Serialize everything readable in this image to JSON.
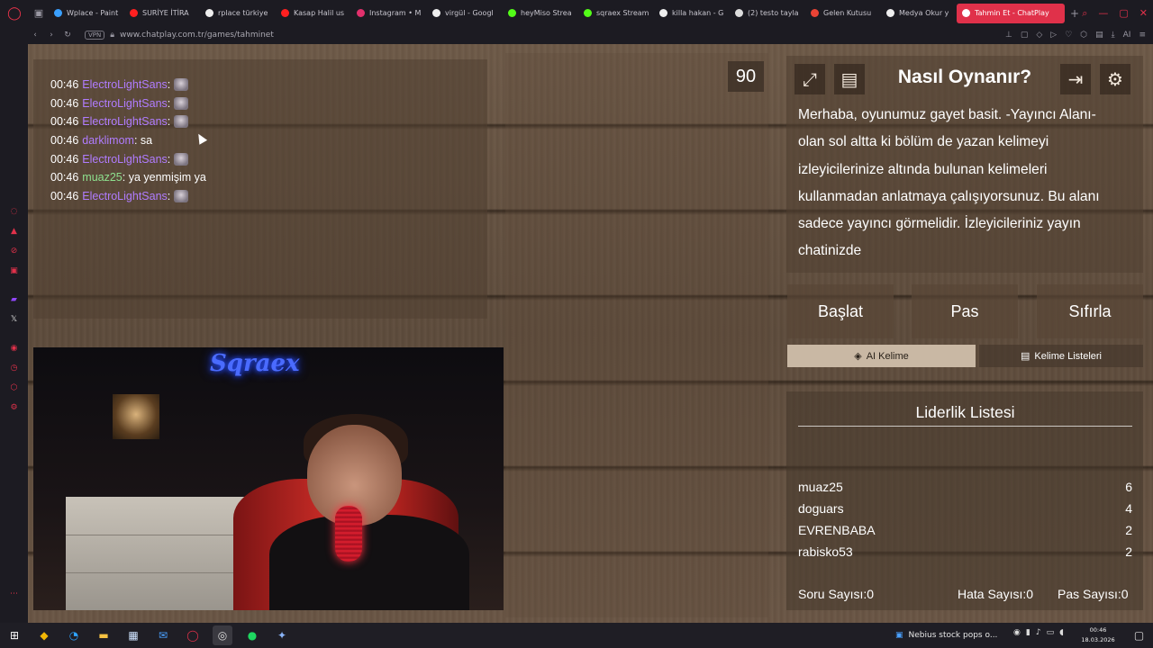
{
  "browser": {
    "tabs": [
      {
        "label": "Wplace - Paint",
        "color": "#3aa0ff"
      },
      {
        "label": "SURİYE İTİRA",
        "color": "#ff2020"
      },
      {
        "label": "rplace türkiye",
        "color": "#eeeeee"
      },
      {
        "label": "Kasap Halil us",
        "color": "#ff2020"
      },
      {
        "label": "Instagram • M",
        "color": "#e1306c"
      },
      {
        "label": "virgül - Googl",
        "color": "#eeeeee"
      },
      {
        "label": "heyMiso Strea",
        "color": "#53fc18"
      },
      {
        "label": "sqraex Stream",
        "color": "#53fc18"
      },
      {
        "label": "killa hakan - G",
        "color": "#eeeeee"
      },
      {
        "label": "(2) testo tayla",
        "color": "#dddddd"
      },
      {
        "label": "Gelen Kutusu",
        "color": "#ea4335"
      },
      {
        "label": "Medya Okur y",
        "color": "#eeeeee"
      },
      {
        "label": "Tahmin Et - ChatPlay",
        "color": "#ffffff",
        "active": true
      }
    ],
    "url": "www.chatplay.com.tr/games/tahminet",
    "vpn_label": "VPN",
    "ai_label": "AI"
  },
  "chat": {
    "messages": [
      {
        "time": "00:46",
        "user": "ElectroLightSans",
        "sep": ":",
        "text": "",
        "emote": true,
        "green": false
      },
      {
        "time": "00:46",
        "user": "ElectroLightSans",
        "sep": ":",
        "text": "",
        "emote": true,
        "green": false
      },
      {
        "time": "00:46",
        "user": "ElectroLightSans",
        "sep": ":",
        "text": "",
        "emote": true,
        "green": false
      },
      {
        "time": "00:46",
        "user": "darklimom",
        "sep": ":",
        "text": " sa",
        "emote": false,
        "green": false
      },
      {
        "time": "00:46",
        "user": "ElectroLightSans",
        "sep": ":",
        "text": "",
        "emote": true,
        "green": false
      },
      {
        "time": "00:46",
        "user": "muaz25",
        "sep": ":",
        "text": " ya yenmişim ya",
        "emote": false,
        "green": true
      },
      {
        "time": "00:46",
        "user": "ElectroLightSans",
        "sep": ":",
        "text": "",
        "emote": true,
        "green": false
      }
    ]
  },
  "webcam": {
    "neon_sign": "Sqraex"
  },
  "game": {
    "timer": "90",
    "how_to_title": "Nasıl Oynanır?",
    "how_to_text": "Merhaba, oyunumuz gayet basit. -Yayıncı Alanı- olan sol altta ki bölüm de yazan kelimeyi izleyicilerinize altında bulunan kelimeleri kullanmadan anlatmaya çalışıyorsunuz. Bu alanı sadece yayıncı görmelidir. İzleyicileriniz yayın chatinizde",
    "buttons": {
      "start": "Başlat",
      "pass": "Pas",
      "reset": "Sıfırla"
    },
    "ai_word": "AI Kelime",
    "word_lists": "Kelime Listeleri",
    "icons": {
      "fullscreen": "expand-icon",
      "notes": "notes-icon",
      "exit": "exit-icon",
      "settings": "gear-icon"
    }
  },
  "leaderboard": {
    "title": "Liderlik Listesi",
    "rows": [
      {
        "name": "muaz25",
        "score": "6"
      },
      {
        "name": "doguars",
        "score": "4"
      },
      {
        "name": "EVRENBABA",
        "score": "2"
      },
      {
        "name": "rabisko53",
        "score": "2"
      }
    ],
    "stats": {
      "questions": "Soru Sayısı:0",
      "errors": "Hata Sayısı:0",
      "passes": "Pas Sayısı:0"
    }
  },
  "taskbar": {
    "news": "Nebius stock pops o...",
    "time": "00:46",
    "date": "18.03.2026"
  },
  "colors": {
    "accent": "#e0314a",
    "username": "#b07cff",
    "username_alt": "#8ee08e",
    "wood": "#6e5a48"
  }
}
